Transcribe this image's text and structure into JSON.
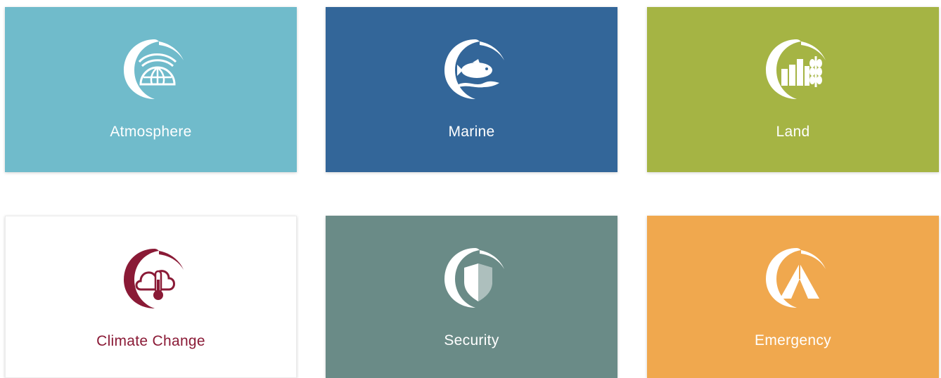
{
  "tiles": {
    "atmosphere": {
      "label": "Atmosphere",
      "icon": "atmosphere-globe-icon",
      "bg": "#70bbcb",
      "fg": "#ffffff"
    },
    "marine": {
      "label": "Marine",
      "icon": "marine-fish-icon",
      "bg": "#336699",
      "fg": "#ffffff"
    },
    "land": {
      "label": "Land",
      "icon": "land-wheat-icon",
      "bg": "#a5b444",
      "fg": "#ffffff"
    },
    "climate": {
      "label": "Climate Change",
      "icon": "climate-thermometer-icon",
      "bg": "#ffffff",
      "fg": "#8a1a36"
    },
    "security": {
      "label": "Security",
      "icon": "security-shield-icon",
      "bg": "#6a8b87",
      "fg": "#ffffff"
    },
    "emergency": {
      "label": "Emergency",
      "icon": "emergency-tent-icon",
      "bg": "#f0a84e",
      "fg": "#ffffff"
    }
  }
}
